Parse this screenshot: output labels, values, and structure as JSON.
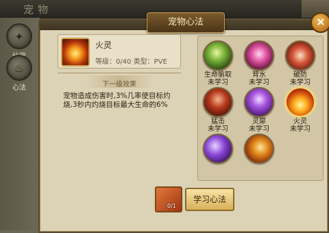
{
  "header": {
    "title": "宠物"
  },
  "sidenav": [
    {
      "label": "仙宠",
      "icon": "pet-icon"
    },
    {
      "label": "心法",
      "icon": "flame-icon"
    }
  ],
  "panel": {
    "title": "宠物心法",
    "close_label": "×"
  },
  "skill_info": {
    "name": "火灵",
    "level_text": "等级：0/40 类型：PVE",
    "next_effect_title": "下一级效果",
    "description": "宠物造成伤害时,3%几率使目标灼烧,3秒内灼烧目标最大生命的6%"
  },
  "skills": [
    {
      "name": "生命偷取",
      "status": "未学习",
      "icon": "life-steal-icon"
    },
    {
      "name": "背水",
      "status": "未学习",
      "icon": "backwater-icon"
    },
    {
      "name": "破防",
      "status": "未学习",
      "icon": "break-defense-icon"
    },
    {
      "name": "猛击",
      "status": "未学习",
      "icon": "smash-icon"
    },
    {
      "name": "灵犀",
      "status": "未学习",
      "icon": "spirit-icon"
    },
    {
      "name": "火灵",
      "status": "未学习",
      "icon": "fire-spirit-icon"
    },
    {
      "name": "",
      "status": "",
      "icon": "purple-skill-icon"
    },
    {
      "name": "",
      "status": "",
      "icon": "claw-skill-icon"
    }
  ],
  "actions": {
    "book_count": "0/1",
    "learn_button": "学习心法"
  }
}
